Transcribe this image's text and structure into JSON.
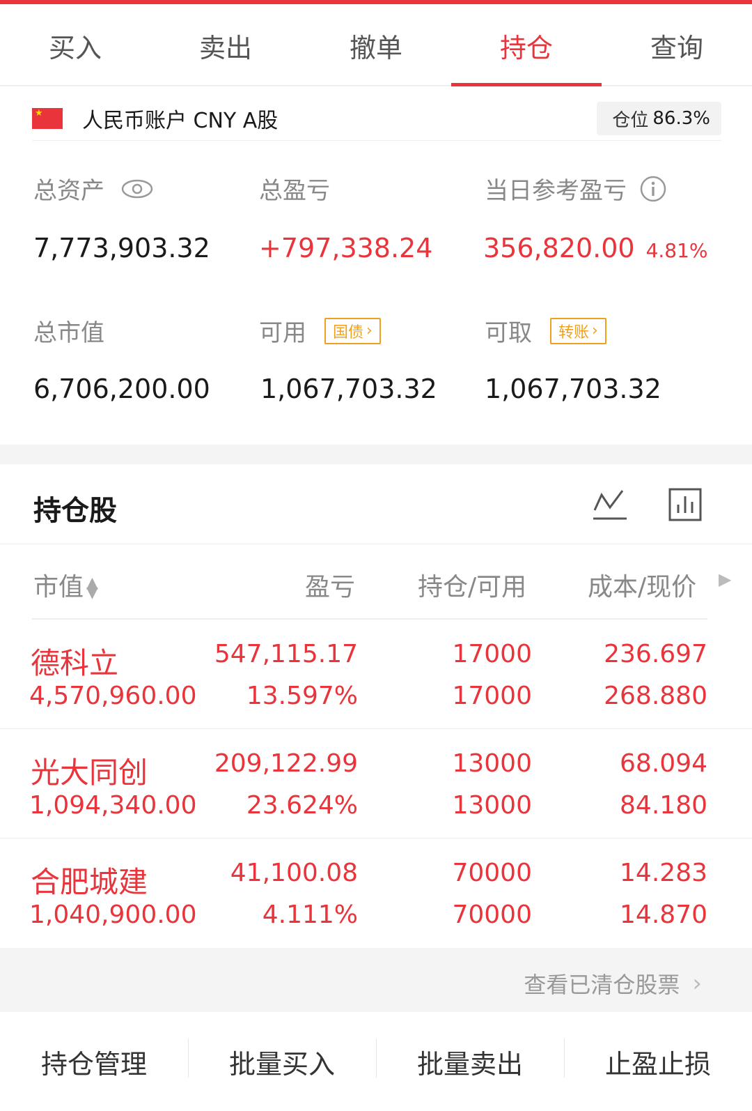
{
  "colors": {
    "accent": "#e8343a",
    "tag_border": "#f0a020",
    "muted": "#888888"
  },
  "tabs": [
    {
      "label": "买入"
    },
    {
      "label": "卖出"
    },
    {
      "label": "撤单"
    },
    {
      "label": "持仓",
      "active": true
    },
    {
      "label": "查询"
    }
  ],
  "account": {
    "flag_icon": "china-flag-icon",
    "label": "人民币账户 CNY A股",
    "position_label": "仓位",
    "position_value": "86.3%"
  },
  "assets": {
    "total_assets_label": "总资产",
    "total_assets_value": "7,773,903.32",
    "total_pl_label": "总盈亏",
    "total_pl_value": "+797,338.24",
    "daily_pl_label": "当日参考盈亏",
    "daily_pl_value": "356,820.00",
    "daily_pl_pct": "4.81%",
    "market_value_label": "总市值",
    "market_value_value": "6,706,200.00",
    "available_label": "可用",
    "available_tag": "国债",
    "available_value": "1,067,703.32",
    "withdrawable_label": "可取",
    "withdrawable_tag": "转账",
    "withdrawable_value": "1,067,703.32"
  },
  "holdings": {
    "title": "持仓股",
    "columns": {
      "market_value": "市值",
      "pl": "盈亏",
      "qty": "持仓/可用",
      "price": "成本/现价"
    },
    "rows": [
      {
        "name": "德科立",
        "market_value": "4,570,960.00",
        "pl": "547,115.17",
        "pl_pct": "13.597%",
        "position": "17000",
        "available": "17000",
        "cost": "236.697",
        "price": "268.880"
      },
      {
        "name": "光大同创",
        "market_value": "1,094,340.00",
        "pl": "209,122.99",
        "pl_pct": "23.624%",
        "position": "13000",
        "available": "13000",
        "cost": "68.094",
        "price": "84.180"
      },
      {
        "name": "合肥城建",
        "market_value": "1,040,900.00",
        "pl": "41,100.08",
        "pl_pct": "4.111%",
        "position": "70000",
        "available": "70000",
        "cost": "14.283",
        "price": "14.870"
      }
    ],
    "cleared_link": "查看已清仓股票"
  },
  "bottom_bar": [
    {
      "label": "持仓管理"
    },
    {
      "label": "批量买入"
    },
    {
      "label": "批量卖出"
    },
    {
      "label": "止盈止损"
    }
  ]
}
